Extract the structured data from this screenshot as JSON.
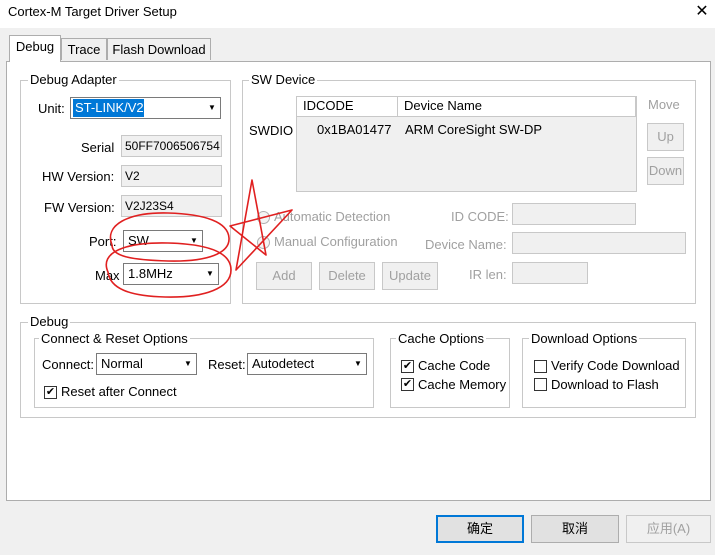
{
  "window": {
    "title": "Cortex-M Target Driver Setup",
    "close": "✕"
  },
  "tabs": [
    {
      "label": "Debug"
    },
    {
      "label": "Trace"
    },
    {
      "label": "Flash Download"
    }
  ],
  "debug_adapter": {
    "legend": "Debug Adapter",
    "unit_label": "Unit:",
    "unit_value": "ST-LINK/V2",
    "serial_label": "Serial",
    "serial_value": "50FF7006506754",
    "hw_label": "HW Version:",
    "hw_value": "V2",
    "fw_label": "FW Version:",
    "fw_value": "V2J23S4",
    "port_label": "Port:",
    "port_value": "SW",
    "max_label": "Max",
    "max_value": "1.8MHz"
  },
  "sw_device": {
    "legend": "SW Device",
    "swdio_label": "SWDIO",
    "columns": [
      "IDCODE",
      "Device Name"
    ],
    "rows": [
      {
        "idcode": "0x1BA01477",
        "device": "ARM CoreSight SW-DP"
      }
    ],
    "move_label": "Move",
    "up": "Up",
    "down": "Down",
    "auto_detect": "Automatic Detection",
    "manual_config": "Manual Configuration",
    "id_code_label": "ID CODE:",
    "device_name_label": "Device Name:",
    "ir_len_label": "IR len:",
    "add": "Add",
    "delete": "Delete",
    "update": "Update"
  },
  "debug": {
    "legend": "Debug",
    "connect_reset": {
      "legend": "Connect & Reset Options",
      "connect_label": "Connect:",
      "connect_value": "Normal",
      "reset_label": "Reset:",
      "reset_value": "Autodetect",
      "reset_after_connect": "Reset after Connect"
    },
    "cache": {
      "legend": "Cache Options",
      "cache_code": "Cache Code",
      "cache_memory": "Cache Memory"
    },
    "download": {
      "legend": "Download Options",
      "verify": "Verify Code Download",
      "flash": "Download to Flash"
    }
  },
  "buttons": {
    "ok": "确定",
    "cancel": "取消",
    "apply": "应用(A)"
  },
  "icons": {
    "check": "✔",
    "arrow": "▼"
  },
  "colors": {
    "selection": "#0078d7",
    "annotation": "#e02020"
  }
}
